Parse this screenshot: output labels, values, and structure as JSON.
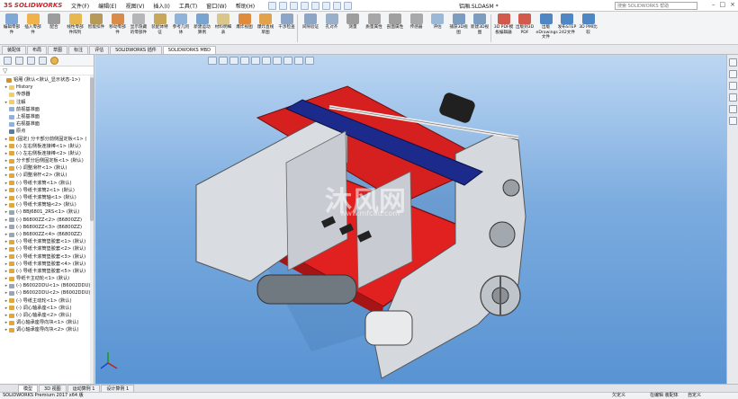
{
  "app": {
    "brand": "SOLIDWORKS",
    "document_title": "铝厢.SLDASM *",
    "help_search_placeholder": "搜索 SOLIDWORKS 帮助"
  },
  "menu": [
    "文件(F)",
    "编辑(E)",
    "视图(V)",
    "插入(I)",
    "工具(T)",
    "窗口(W)",
    "帮助(H)"
  ],
  "commands": [
    {
      "label": "编辑零部件",
      "color": "#7fa8d6"
    },
    {
      "label": "插入零部件",
      "color": "#f0b24a"
    },
    {
      "label": "配合",
      "color": "#9c9c9c"
    },
    {
      "label": "线性零部件阵列",
      "color": "#e6b84d"
    },
    {
      "label": "智能扣件",
      "color": "#b79a5a"
    },
    {
      "label": "移动零部件",
      "color": "#d98b4a"
    },
    {
      "label": "显示隐藏的零部件",
      "color": "#b6b6b6"
    },
    {
      "label": "装配体特征",
      "color": "#c7a85a"
    },
    {
      "label": "参考几何体",
      "color": "#8fb3d9"
    },
    {
      "label": "新建运动算例",
      "color": "#7aa4d0"
    },
    {
      "label": "材料明细表",
      "color": "#d8c68a"
    },
    {
      "label": "爆炸视图",
      "color": "#e08a3c"
    },
    {
      "label": "爆炸直线草图",
      "color": "#e2a24b"
    },
    {
      "label": "干涉检查",
      "color": "#8da6c6"
    },
    {
      "label": "间隙验证",
      "color": "#8da6c6"
    },
    {
      "label": "孔对齐",
      "color": "#9ab0c8"
    },
    {
      "label": "测量",
      "color": "#9e9e9e"
    },
    {
      "label": "质量属性",
      "color": "#a7a7a7"
    },
    {
      "label": "剖面属性",
      "color": "#a0a0a0"
    },
    {
      "label": "传感器",
      "color": "#a9a9a9"
    },
    {
      "label": "评估",
      "color": "#9bb9d6"
    },
    {
      "label": "捕获3D视图",
      "color": "#7c9cc0"
    },
    {
      "label": "新建3D视图",
      "color": "#7c9cc0"
    },
    {
      "label": "3D PDF模板编辑器",
      "color": "#d15a4c"
    },
    {
      "label": "出版到3D PDF",
      "color": "#d15a4c"
    },
    {
      "label": "出版eDrawings文件",
      "color": "#4f87c4"
    },
    {
      "label": "发布STEP 242文件",
      "color": "#4f87c4"
    },
    {
      "label": "3D PMI比较",
      "color": "#4f87c4"
    }
  ],
  "tabs": [
    "装配体",
    "布局",
    "草图",
    "标注",
    "评估",
    "SOLIDWORKS 插件",
    "SOLIDWORKS MBD"
  ],
  "active_tab": 6,
  "tree": [
    {
      "label": "铝厢 (默认<默认_显示状态-1>)",
      "icon": "asm",
      "indent": 0,
      "exp": ""
    },
    {
      "label": "History",
      "icon": "folder",
      "indent": 1,
      "exp": "▸"
    },
    {
      "label": "传感器",
      "icon": "folder",
      "indent": 1,
      "exp": ""
    },
    {
      "label": "注解",
      "icon": "folder",
      "indent": 1,
      "exp": "▸"
    },
    {
      "label": "前视基准面",
      "icon": "plane",
      "indent": 1,
      "exp": ""
    },
    {
      "label": "上视基准面",
      "icon": "plane",
      "indent": 1,
      "exp": ""
    },
    {
      "label": "右视基准面",
      "icon": "plane",
      "indent": 1,
      "exp": ""
    },
    {
      "label": "原点",
      "icon": "org",
      "indent": 1,
      "exp": ""
    },
    {
      "label": "(固定) 分卡部分前侧固定板<1> (",
      "icon": "part",
      "indent": 1,
      "exp": "▸"
    },
    {
      "label": "(-) 左右侧板连接棒<1> (默认)",
      "icon": "part",
      "indent": 1,
      "exp": "▸"
    },
    {
      "label": "(-) 左右侧板连接棒<2> (默认)",
      "icon": "part",
      "indent": 1,
      "exp": "▸"
    },
    {
      "label": "分卡部分后侧固定板<1> (默认)",
      "icon": "part",
      "indent": 1,
      "exp": "▸"
    },
    {
      "label": "(-) 调整滑杆<1> (默认)",
      "icon": "part",
      "indent": 1,
      "exp": "▸"
    },
    {
      "label": "(-) 调整滑杆<2> (默认)",
      "icon": "part",
      "indent": 1,
      "exp": "▸"
    },
    {
      "label": "(-) 导纸卡滚筒<1> (默认)",
      "icon": "part",
      "indent": 1,
      "exp": "▸"
    },
    {
      "label": "(-) 导纸卡滚筒2<1> (默认)",
      "icon": "part",
      "indent": 1,
      "exp": "▸"
    },
    {
      "label": "(-) 导纸卡滚筒轴<1> (默认)",
      "icon": "part",
      "indent": 1,
      "exp": "▸"
    },
    {
      "label": "(-) 导纸卡滚筒轴<2> (默认)",
      "icon": "part",
      "indent": 1,
      "exp": "▸"
    },
    {
      "label": "(-) BBJ6801_2RS<1> (默认)",
      "icon": "gear",
      "indent": 1,
      "exp": "▸"
    },
    {
      "label": "(-) B6800ZZ<2> (B6800ZZ)",
      "icon": "gear",
      "indent": 1,
      "exp": "▸"
    },
    {
      "label": "(-) B6800ZZ<3> (B6800ZZ)",
      "icon": "gear",
      "indent": 1,
      "exp": "▸"
    },
    {
      "label": "(-) B6800ZZ<4> (B6800ZZ)",
      "icon": "gear",
      "indent": 1,
      "exp": "▸"
    },
    {
      "label": "(-) 导纸卡滚筒垫胶套<1> (默认)",
      "icon": "part",
      "indent": 1,
      "exp": "▸"
    },
    {
      "label": "(-) 导纸卡滚筒垫胶套<2> (默认)",
      "icon": "part",
      "indent": 1,
      "exp": "▸"
    },
    {
      "label": "(-) 导纸卡滚筒垫胶套<3> (默认)",
      "icon": "part",
      "indent": 1,
      "exp": "▸"
    },
    {
      "label": "(-) 导纸卡滚筒垫胶套<4> (默认)",
      "icon": "part",
      "indent": 1,
      "exp": "▸"
    },
    {
      "label": "(-) 导纸卡滚筒垫胶套<5> (默认)",
      "icon": "part",
      "indent": 1,
      "exp": "▸"
    },
    {
      "label": "导纸卡主动轮<1> (默认)",
      "icon": "part",
      "indent": 1,
      "exp": "▸"
    },
    {
      "label": "(-) B6002DDU<1> (B6002DDU)",
      "icon": "gear",
      "indent": 1,
      "exp": "▸"
    },
    {
      "label": "(-) B6002DDU<2> (B6002DDU)",
      "icon": "gear",
      "indent": 1,
      "exp": "▸"
    },
    {
      "label": "(-) 导纸主动轮<1> (默认)",
      "icon": "part",
      "indent": 1,
      "exp": "▸"
    },
    {
      "label": "(-) 调心轴承座<1> (默认)",
      "icon": "part",
      "indent": 1,
      "exp": "▸"
    },
    {
      "label": "(-) 调心轴承座<2> (默认)",
      "icon": "part",
      "indent": 1,
      "exp": "▸"
    },
    {
      "label": "调心轴承座导向块<1> (默认)",
      "icon": "part",
      "indent": 1,
      "exp": "▸"
    },
    {
      "label": "调心轴承座导向块<2> (默认)",
      "icon": "part",
      "indent": 1,
      "exp": "▸"
    }
  ],
  "watermark": {
    "main": "沐风网",
    "sub": "www.mfcad.com"
  },
  "bottom_tabs": [
    "模型",
    "3D 视图",
    "运动算例 1",
    "设计算例 1"
  ],
  "status": {
    "left": "SOLIDWORKS Premium 2017 x64 版",
    "right1": "欠定义",
    "right2": "在编辑 装配体",
    "right3": "自定义"
  }
}
